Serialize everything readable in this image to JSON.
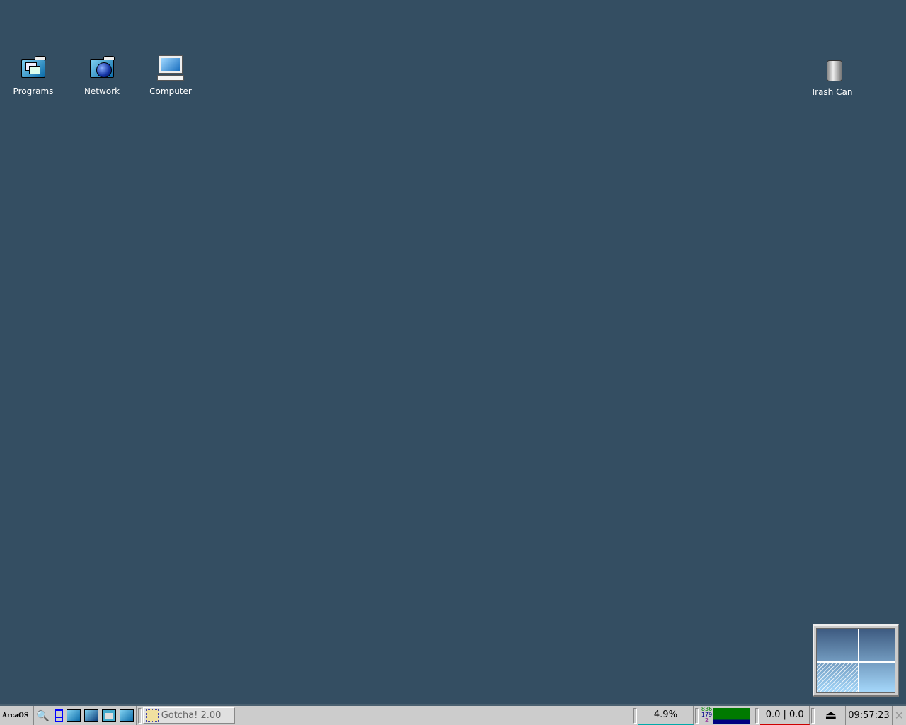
{
  "desktop": {
    "background": "#344e62",
    "icons": [
      {
        "label": "Programs",
        "icon": "programs-folder-icon"
      },
      {
        "label": "Network",
        "icon": "network-folder-icon"
      },
      {
        "label": "Computer",
        "icon": "computer-icon"
      },
      {
        "label": "Trash Can",
        "icon": "trash-can-icon"
      }
    ]
  },
  "taskbar": {
    "logo": "ArcaOS",
    "quicklaunch": [
      "search-icon",
      "window-list-icon",
      "drives-folder-icon",
      "desktop-folder-icon",
      "system-setup-icon",
      "programs-folder-icon"
    ],
    "task": {
      "label": "Gotcha! 2.00"
    },
    "cpu": "4.9%",
    "mem": {
      "line1": "836",
      "line2": "179",
      "line3": "2"
    },
    "net": "0.0 | 0.0",
    "clock": "09:57:23"
  },
  "pager": {
    "desktops": 4,
    "active": 3
  }
}
